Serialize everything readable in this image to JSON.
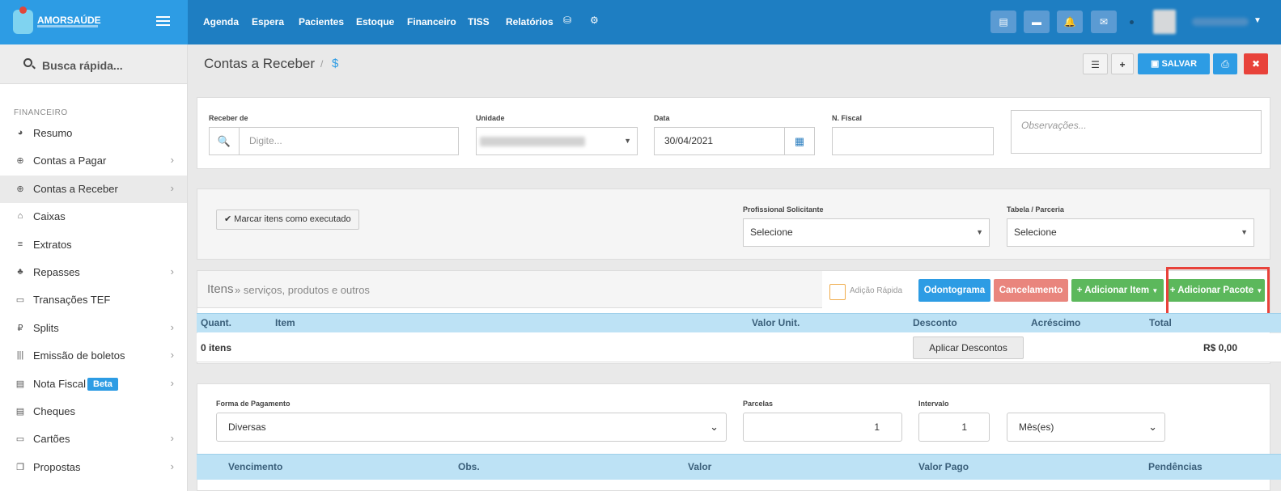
{
  "brand": {
    "name": "AMORSAÚDE"
  },
  "topnav": {
    "items": [
      "Agenda",
      "Espera",
      "Pacientes",
      "Estoque",
      "Financeiro",
      "TISS",
      "Relatórios"
    ]
  },
  "icons": {
    "top_buttons": [
      "inbox-icon",
      "card-icon",
      "bell-icon",
      "chat-icon"
    ],
    "nav_extra": [
      "database-icon",
      "gear-icon"
    ]
  },
  "sidebar": {
    "search_placeholder": "Busca rápida...",
    "section": "FINANCEIRO",
    "items": [
      {
        "label": "Resumo",
        "icon": "◕",
        "chevron": false
      },
      {
        "label": "Contas a Pagar",
        "icon": "⊕",
        "chevron": true
      },
      {
        "label": "Contas a Receber",
        "icon": "⊕",
        "chevron": true,
        "active": true
      },
      {
        "label": "Caixas",
        "icon": "⌂",
        "chevron": false
      },
      {
        "label": "Extratos",
        "icon": "≡",
        "chevron": false
      },
      {
        "label": "Repasses",
        "icon": "♣",
        "chevron": true
      },
      {
        "label": "Transações TEF",
        "icon": "▭",
        "chevron": false
      },
      {
        "label": "Splits",
        "icon": "₽",
        "chevron": true
      },
      {
        "label": "Emissão de boletos",
        "icon": "|||",
        "chevron": true
      },
      {
        "label": "Nota Fiscal",
        "icon": "▤",
        "chevron": true,
        "badge": "Beta"
      },
      {
        "label": "Cheques",
        "icon": "▤",
        "chevron": false
      },
      {
        "label": "Cartões",
        "icon": "▭",
        "chevron": true
      },
      {
        "label": "Propostas",
        "icon": "❐",
        "chevron": true
      }
    ]
  },
  "page": {
    "title": "Contas a Receber",
    "breadcrumb_sep": "/",
    "icon": "$"
  },
  "actions": {
    "save": "SALVAR"
  },
  "form": {
    "receber_de": {
      "label": "Receber de",
      "placeholder": "Digite..."
    },
    "unidade": {
      "label": "Unidade"
    },
    "data": {
      "label": "Data",
      "value": "30/04/2021"
    },
    "nfiscal": {
      "label": "N. Fiscal",
      "value": ""
    },
    "obs": {
      "placeholder": "Observações..."
    }
  },
  "execution": {
    "mark_button": "Marcar itens como executado",
    "profissional": {
      "label": "Profissional Solicitante",
      "value": "Selecione"
    },
    "tabela": {
      "label": "Tabela / Parceria",
      "value": "Selecione"
    }
  },
  "items": {
    "title": "Itens",
    "subtitle": "» serviços, produtos e outros",
    "quick_add": "Adição Rápida",
    "buttons": {
      "odontograma": "Odontograma",
      "cancelamento": "Cancelamento",
      "adicionar_item": "Adicionar Item",
      "adicionar_pacote": "Adicionar Pacote"
    },
    "columns": [
      "Quant.",
      "Item",
      "Valor Unit.",
      "Desconto",
      "Acréscimo",
      "Total"
    ],
    "count": "0 itens",
    "apply_discounts": "Aplicar Descontos",
    "total": "R$ 0,00"
  },
  "payment": {
    "forma": {
      "label": "Forma de Pagamento",
      "value": "Diversas"
    },
    "parcelas": {
      "label": "Parcelas",
      "value": "1"
    },
    "intervalo": {
      "label": "Intervalo",
      "value": "1"
    },
    "unidade_intervalo": "Mês(es)",
    "columns": [
      "Vencimento",
      "Obs.",
      "Valor",
      "Valor Pago",
      "Pendências"
    ]
  },
  "colors": {
    "topbar": "#1e7ec2",
    "brand": "#2d9ce4",
    "primary": "#2d9ce4",
    "success": "#5cb85c",
    "danger": "#e8423a",
    "muted_danger": "#e9857d",
    "table_head": "#bde2f5"
  }
}
